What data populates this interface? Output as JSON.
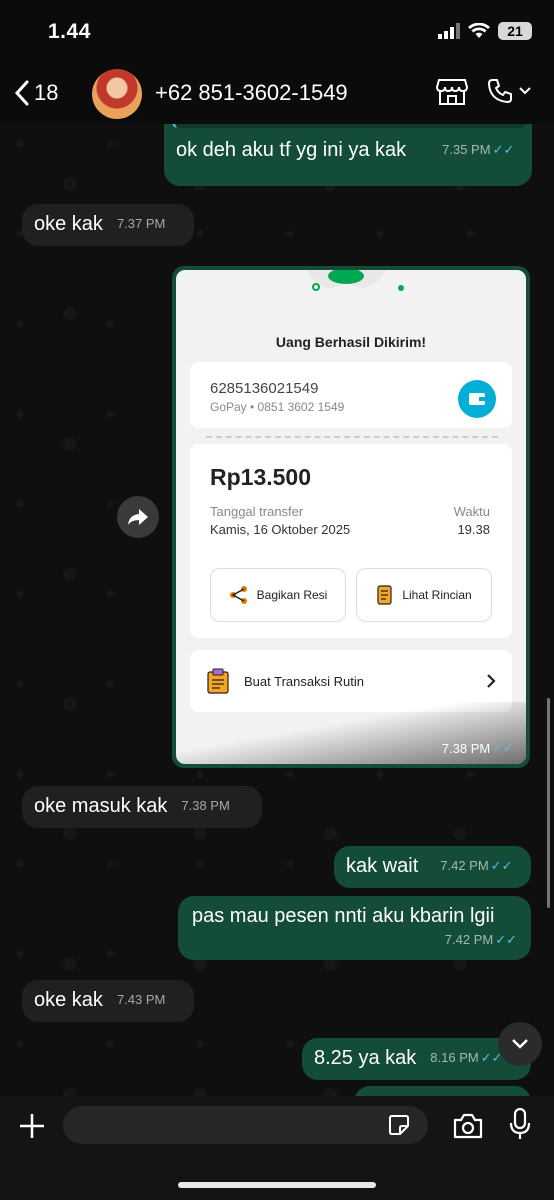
{
  "status": {
    "time": "1.44",
    "battery": "21"
  },
  "header": {
    "back_count": "18",
    "contact": "+62 851-3602-1549"
  },
  "messages": [
    {
      "text": "ok deh aku tf yg ini ya kak",
      "time": "7.35 PM",
      "ticks": "✓✓"
    },
    {
      "text": "oke kak",
      "time": "7.37 PM"
    },
    {
      "time": "7.38 PM",
      "ticks": "✓✓"
    },
    {
      "text": "oke masuk kak",
      "time": "7.38 PM"
    },
    {
      "text": "kak wait",
      "time": "7.42 PM",
      "ticks": "✓✓"
    },
    {
      "text": "pas mau pesen nnti aku kbarin lgii",
      "time": "7.42 PM",
      "ticks": "✓✓"
    },
    {
      "text": "oke kak",
      "time": "7.43 PM"
    },
    {
      "text": "8.25 ya kak",
      "time": "8.16 PM",
      "ticks": "✓✓"
    }
  ],
  "receipt": {
    "title": "Uang Berhasil Dikirim!",
    "account": "6285136021549",
    "account_sub": "GoPay • 0851 3602 1549",
    "amount": "Rp13.500",
    "date_label": "Tanggal transfer",
    "date_value": "Kamis, 16 Oktober 2025",
    "time_label": "Waktu",
    "time_value": "19.38",
    "share_label": "Bagikan Resi",
    "detail_label": "Lihat Rincian",
    "routine_label": "Buat Transaksi Rutin"
  },
  "colors": {
    "outgoing": "#144d37",
    "incoming": "#202020",
    "read_ticks": "#53bdeb",
    "gopay": "#00aed6"
  }
}
